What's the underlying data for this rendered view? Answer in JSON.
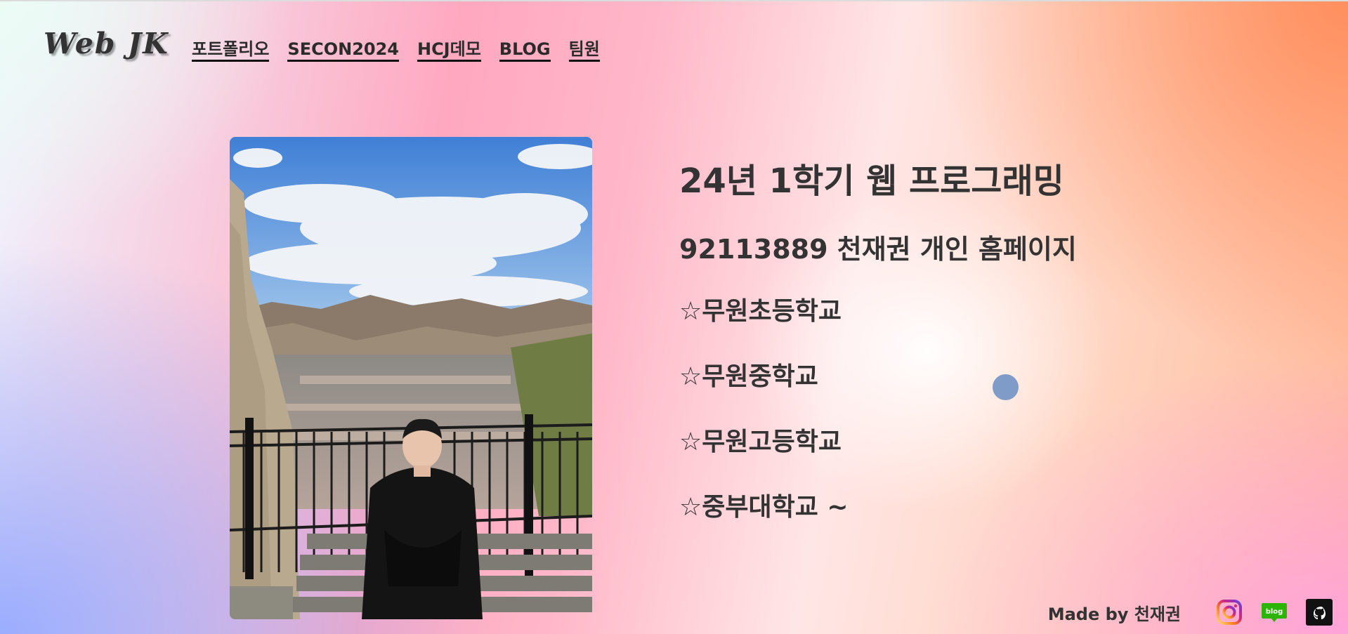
{
  "header": {
    "logo": "Web JK",
    "nav": [
      {
        "label": "포트폴리오"
      },
      {
        "label": "SECON2024"
      },
      {
        "label": "HCJ데모"
      },
      {
        "label": "BLOG"
      },
      {
        "label": "팀원"
      }
    ]
  },
  "main": {
    "title": "24년 1학기 웹 프로그래밍",
    "subtitle": "92113889 천재권 개인 홈페이지",
    "schools": [
      "☆무원초등학교",
      "☆무원중학교",
      "☆무원고등학교",
      "☆중부대학교 ~"
    ]
  },
  "footer": {
    "made_by": "Made by 천재권",
    "icons": [
      "instagram-icon",
      "naver-blog-icon",
      "github-icon"
    ],
    "blog_icon_text": "blog"
  },
  "colors": {
    "text": "#333333",
    "cursor": "#7f9cc8",
    "blog_green": "#2db400"
  }
}
